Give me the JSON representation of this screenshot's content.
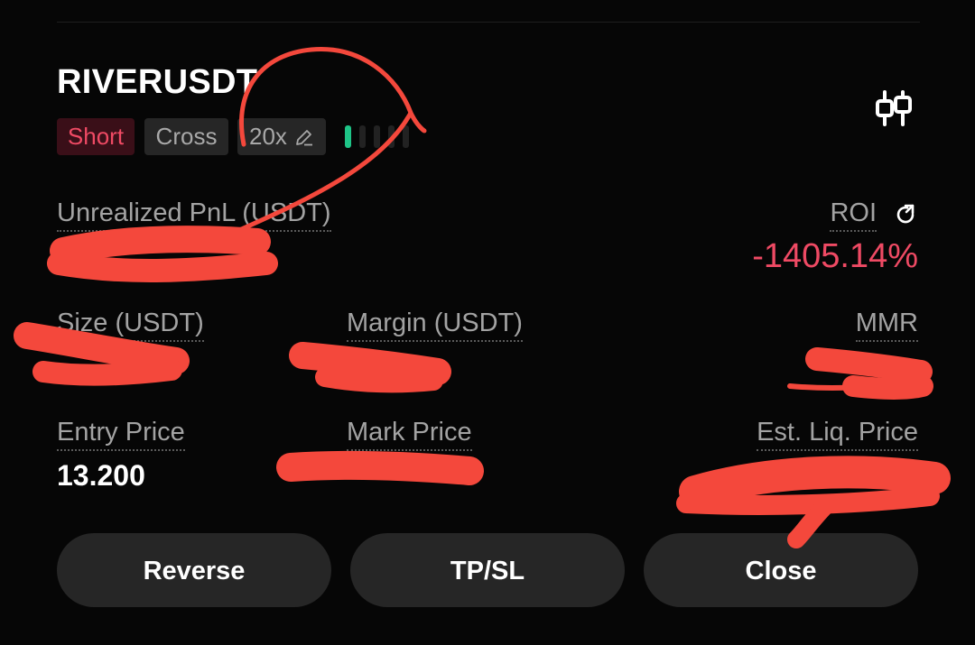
{
  "position": {
    "symbol": "RIVERUSDT",
    "side": "Short",
    "margin_mode": "Cross",
    "leverage": "20x",
    "adl_level": 1,
    "adl_total": 5
  },
  "fields": {
    "unrealized_pnl_label": "Unrealized PnL (USDT)",
    "roi_label": "ROI",
    "roi_value": "-1405.14%",
    "size_label": "Size (USDT)",
    "margin_label": "Margin (USDT)",
    "mmr_label": "MMR",
    "entry_price_label": "Entry Price",
    "entry_price_value": "13.200",
    "mark_price_label": "Mark Price",
    "liq_price_label": "Est. Liq. Price"
  },
  "actions": {
    "reverse": "Reverse",
    "tpsl": "TP/SL",
    "close": "Close"
  },
  "colors": {
    "short": "#ef4a64",
    "adl_active": "#1ec487",
    "scribble": "#f4483c"
  },
  "icons": [
    "settings-sliders-icon",
    "edit-pencil-icon",
    "refresh-share-icon"
  ]
}
